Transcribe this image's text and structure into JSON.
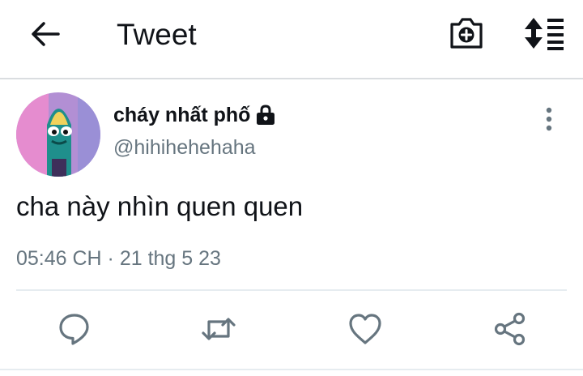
{
  "header": {
    "title": "Tweet",
    "back_icon": "arrow-left-icon",
    "camera_icon": "camera-add-icon",
    "sort_icon": "sort-list-icon"
  },
  "tweet": {
    "author": {
      "display_name": "cháy nhất phố",
      "handle": "@hihihehehaha",
      "protected_icon": "lock-icon",
      "avatar": "avatar-image"
    },
    "text": "cha này nhìn quen quen",
    "timestamp": "05:46 CH · 21 thg 5 23"
  },
  "actions": [
    {
      "name": "reply",
      "icon": "reply-icon"
    },
    {
      "name": "retweet",
      "icon": "retweet-icon"
    },
    {
      "name": "like",
      "icon": "heart-icon"
    },
    {
      "name": "share",
      "icon": "share-icon"
    }
  ],
  "colors": {
    "text_primary": "#101318",
    "text_secondary": "#66757f",
    "icon_gray": "#66757f",
    "divider": "#e6ecf0"
  }
}
